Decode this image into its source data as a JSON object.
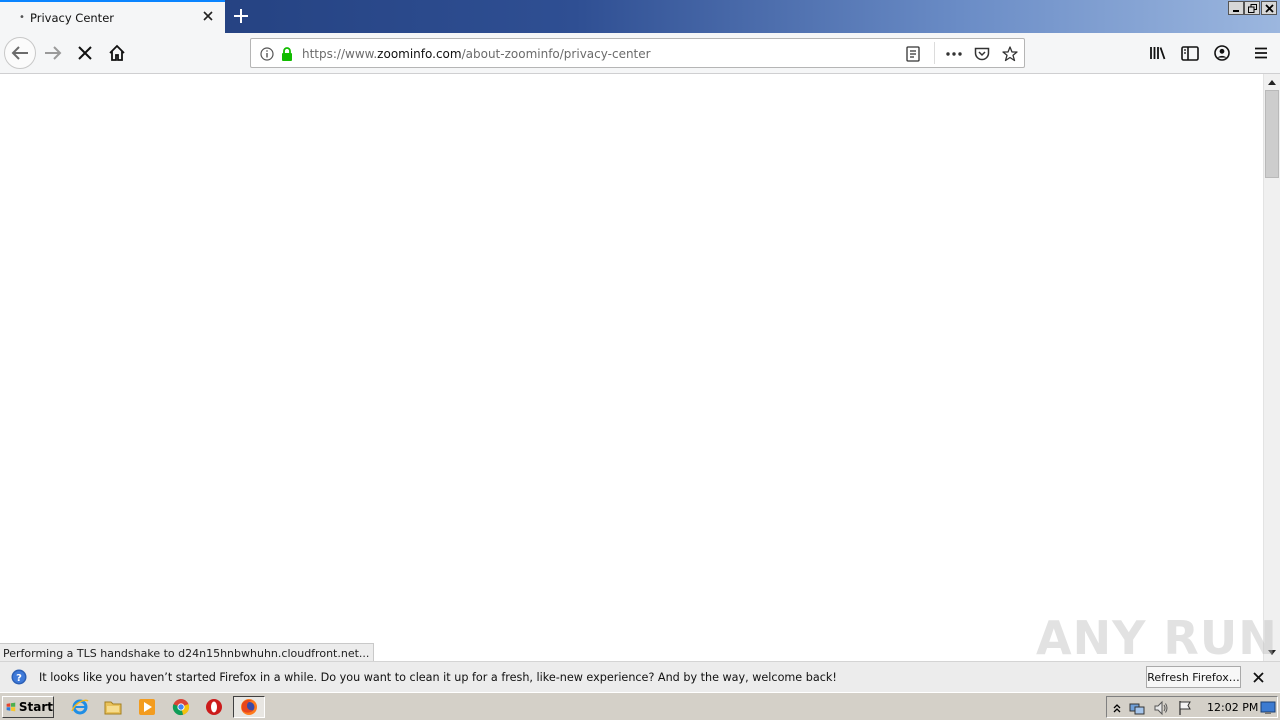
{
  "browser": {
    "tab": {
      "title": "Privacy Center",
      "loading_dot": "•"
    },
    "window_controls": [
      "minimize",
      "restore",
      "close"
    ]
  },
  "toolbar": {
    "url": {
      "prefix": "https://www.",
      "host": "zoominfo.com",
      "path": "/about-zoominfo/privacy-center"
    }
  },
  "status_text": "Performing a TLS handshake to d24n15hnbwhuhn.cloudfront.net...",
  "watermark_text": "ANY RUN",
  "notification": {
    "message": "It looks like you haven’t started Firefox in a while. Do you want to clean it up for a fresh, like-new experience? And by the way, welcome back!",
    "button_label": "Refresh Firefox…"
  },
  "taskbar": {
    "start_label": "Start",
    "clock": "12:02 PM",
    "quick_launch": [
      "internet-explorer-icon",
      "folder-icon",
      "media-player-icon",
      "chrome-icon",
      "opera-icon"
    ]
  },
  "colors": {
    "accent": "#0a84ff",
    "lock_green": "#12bc00",
    "title_gradient_start": "#1f3b78",
    "taskbar": "#d4d0c8"
  }
}
